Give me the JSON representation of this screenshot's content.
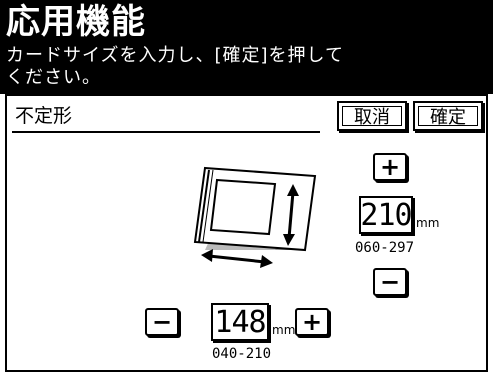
{
  "header": {
    "title": "応用機能",
    "message_line1": "カードサイズを入力し、[確定]を押して",
    "message_line2": "ください。"
  },
  "panel": {
    "title": "不定形",
    "cancel_label": "取消",
    "ok_label": "確定"
  },
  "height": {
    "plus_label": "+",
    "minus_label": "−",
    "value": "210",
    "unit": "mm",
    "range": "060-297"
  },
  "width": {
    "plus_label": "+",
    "minus_label": "−",
    "value": "148",
    "unit": "mm",
    "range": "040-210"
  },
  "illustration": {
    "icon": "card-size-scan-icon"
  }
}
